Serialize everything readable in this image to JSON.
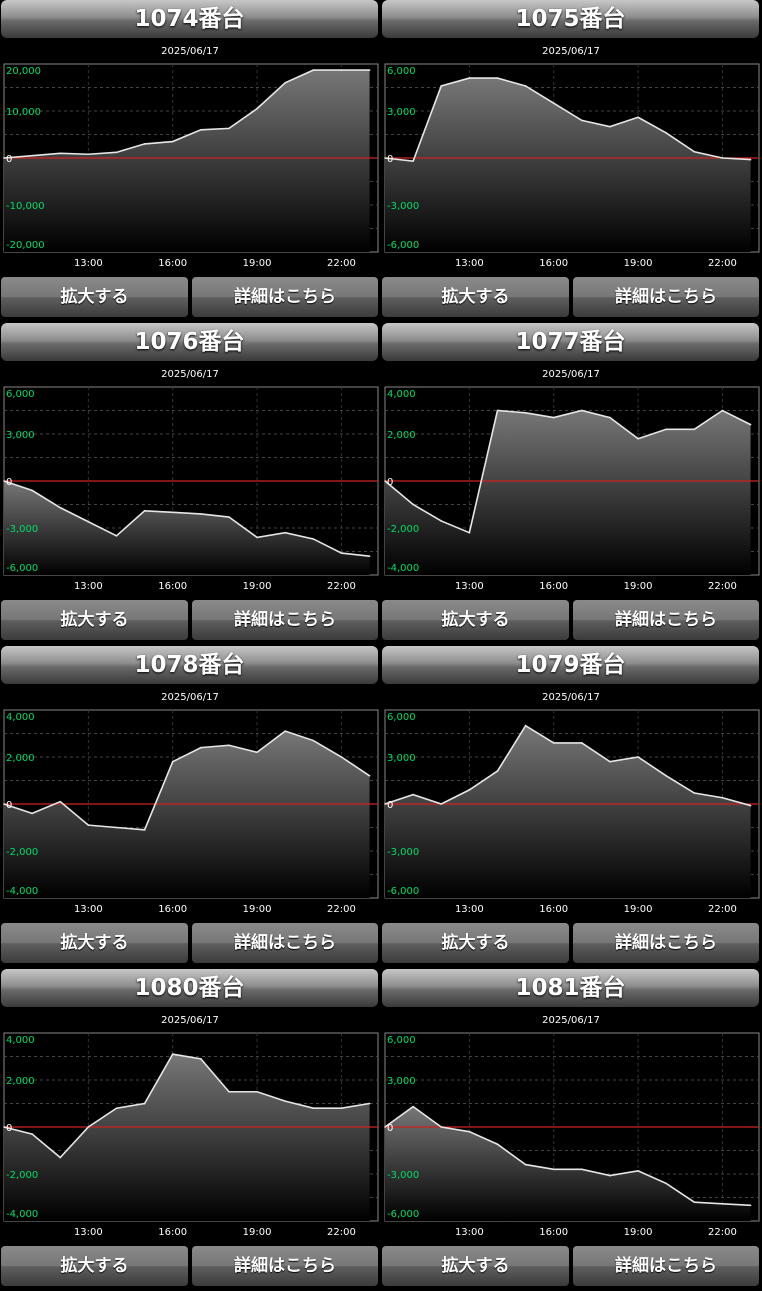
{
  "labels": {
    "zoom": "拡大する",
    "detail": "詳細はこちら"
  },
  "colors": {
    "zero_line": "#cc2222",
    "tick_text": "#00dd66",
    "line": "#e6e6e6"
  },
  "chart_data": [
    {
      "type": "area",
      "title": "1074番台",
      "date": "2025/06/17",
      "x_ticks": [
        "13:00",
        "16:00",
        "19:00",
        "22:00"
      ],
      "y_ticks": [
        "20,000",
        "10,000",
        "0",
        "-10,000",
        "-20,000"
      ],
      "ylim": [
        -20000,
        20000
      ],
      "grid": true,
      "x": [
        10,
        11,
        12,
        13,
        14,
        15,
        16,
        17,
        18,
        19,
        20,
        21,
        22,
        23
      ],
      "values": [
        0,
        500,
        1000,
        800,
        1200,
        3000,
        3500,
        6000,
        6300,
        10500,
        16000,
        18700,
        18700,
        18700
      ]
    },
    {
      "type": "area",
      "title": "1075番台",
      "date": "2025/06/17",
      "x_ticks": [
        "13:00",
        "16:00",
        "19:00",
        "22:00"
      ],
      "y_ticks": [
        "6,000",
        "3,000",
        "0",
        "-3,000",
        "-6,000"
      ],
      "ylim": [
        -6000,
        6000
      ],
      "grid": true,
      "x": [
        10,
        11,
        12,
        13,
        14,
        15,
        16,
        17,
        18,
        19,
        20,
        21,
        22,
        23
      ],
      "values": [
        0,
        -200,
        4600,
        5100,
        5100,
        4600,
        3500,
        2400,
        2000,
        2600,
        1600,
        400,
        0,
        -100
      ]
    },
    {
      "type": "area",
      "title": "1076番台",
      "date": "2025/06/17",
      "x_ticks": [
        "13:00",
        "16:00",
        "19:00",
        "22:00"
      ],
      "y_ticks": [
        "6,000",
        "3,000",
        "0",
        "-3,000",
        "-6,000"
      ],
      "ylim": [
        -6000,
        6000
      ],
      "grid": true,
      "x": [
        10,
        11,
        12,
        13,
        14,
        15,
        16,
        17,
        18,
        19,
        20,
        21,
        22,
        23
      ],
      "values": [
        0,
        -600,
        -1700,
        -2600,
        -3500,
        -1900,
        -2000,
        -2100,
        -2300,
        -3600,
        -3300,
        -3700,
        -4600,
        -4800
      ]
    },
    {
      "type": "area",
      "title": "1077番台",
      "date": "2025/06/17",
      "x_ticks": [
        "13:00",
        "16:00",
        "19:00",
        "22:00"
      ],
      "y_ticks": [
        "4,000",
        "2,000",
        "0",
        "-2,000",
        "-4,000"
      ],
      "ylim": [
        -4000,
        4000
      ],
      "grid": true,
      "x": [
        10,
        11,
        12,
        13,
        14,
        15,
        16,
        17,
        18,
        19,
        20,
        21,
        22,
        23
      ],
      "values": [
        0,
        -1000,
        -1700,
        -2200,
        3000,
        2900,
        2700,
        3000,
        2700,
        1800,
        2200,
        2200,
        3000,
        2400
      ]
    },
    {
      "type": "area",
      "title": "1078番台",
      "date": "2025/06/17",
      "x_ticks": [
        "13:00",
        "16:00",
        "19:00",
        "22:00"
      ],
      "y_ticks": [
        "4,000",
        "2,000",
        "0",
        "-2,000",
        "-4,000"
      ],
      "ylim": [
        -4000,
        4000
      ],
      "grid": true,
      "x": [
        10,
        11,
        12,
        13,
        14,
        15,
        16,
        17,
        18,
        19,
        20,
        21,
        22,
        23
      ],
      "values": [
        0,
        -400,
        100,
        -900,
        -1000,
        -1100,
        1800,
        2400,
        2500,
        2200,
        3100,
        2700,
        2000,
        1200
      ]
    },
    {
      "type": "area",
      "title": "1079番台",
      "date": "2025/06/17",
      "x_ticks": [
        "13:00",
        "16:00",
        "19:00",
        "22:00"
      ],
      "y_ticks": [
        "6,000",
        "3,000",
        "0",
        "-3,000",
        "-6,000"
      ],
      "ylim": [
        -6000,
        6000
      ],
      "grid": true,
      "x": [
        10,
        11,
        12,
        13,
        14,
        15,
        16,
        17,
        18,
        19,
        20,
        21,
        22,
        23
      ],
      "values": [
        0,
        600,
        0,
        900,
        2100,
        5000,
        3900,
        3900,
        2700,
        3000,
        1800,
        700,
        400,
        -100
      ]
    },
    {
      "type": "area",
      "title": "1080番台",
      "date": "2025/06/17",
      "x_ticks": [
        "13:00",
        "16:00",
        "19:00",
        "22:00"
      ],
      "y_ticks": [
        "4,000",
        "2,000",
        "0",
        "-2,000",
        "-4,000"
      ],
      "ylim": [
        -4000,
        4000
      ],
      "grid": true,
      "x": [
        10,
        11,
        12,
        13,
        14,
        15,
        16,
        17,
        18,
        19,
        20,
        21,
        22,
        23
      ],
      "values": [
        0,
        -300,
        -1300,
        0,
        800,
        1000,
        3100,
        2900,
        1500,
        1500,
        1100,
        800,
        800,
        1000
      ]
    },
    {
      "type": "area",
      "title": "1081番台",
      "date": "2025/06/17",
      "x_ticks": [
        "13:00",
        "16:00",
        "19:00",
        "22:00"
      ],
      "y_ticks": [
        "6,000",
        "3,000",
        "0",
        "-3,000",
        "-6,000"
      ],
      "ylim": [
        -6000,
        6000
      ],
      "grid": true,
      "x": [
        10,
        11,
        12,
        13,
        14,
        15,
        16,
        17,
        18,
        19,
        20,
        21,
        22,
        23
      ],
      "values": [
        0,
        1300,
        0,
        -300,
        -1100,
        -2400,
        -2700,
        -2700,
        -3100,
        -2800,
        -3600,
        -4800,
        -4900,
        -5000
      ]
    }
  ]
}
